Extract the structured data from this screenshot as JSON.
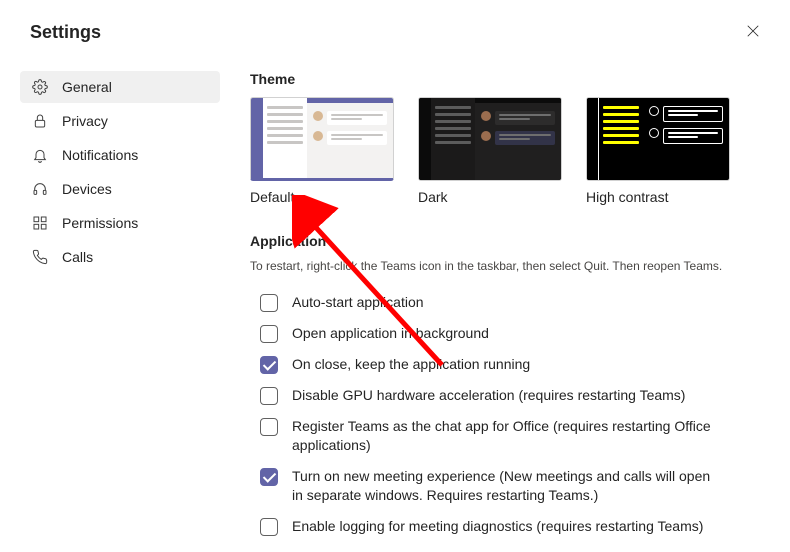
{
  "header": {
    "title": "Settings"
  },
  "sidebar": {
    "items": [
      {
        "key": "general",
        "label": "General",
        "active": true
      },
      {
        "key": "privacy",
        "label": "Privacy",
        "active": false
      },
      {
        "key": "notifications",
        "label": "Notifications",
        "active": false
      },
      {
        "key": "devices",
        "label": "Devices",
        "active": false
      },
      {
        "key": "permissions",
        "label": "Permissions",
        "active": false
      },
      {
        "key": "calls",
        "label": "Calls",
        "active": false
      }
    ]
  },
  "theme": {
    "section_title": "Theme",
    "options": [
      {
        "key": "default",
        "label": "Default",
        "selected": true
      },
      {
        "key": "dark",
        "label": "Dark",
        "selected": false
      },
      {
        "key": "high-contrast",
        "label": "High contrast",
        "selected": false
      }
    ]
  },
  "application": {
    "section_title": "Application",
    "hint": "To restart, right-click the Teams icon in the taskbar, then select Quit. Then reopen Teams.",
    "options": [
      {
        "key": "auto-start",
        "label": "Auto-start application",
        "checked": false
      },
      {
        "key": "open-bg",
        "label": "Open application in background",
        "checked": false
      },
      {
        "key": "on-close-run",
        "label": "On close, keep the application running",
        "checked": true
      },
      {
        "key": "disable-gpu",
        "label": "Disable GPU hardware acceleration (requires restarting Teams)",
        "checked": false
      },
      {
        "key": "reg-chat-app",
        "label": "Register Teams as the chat app for Office (requires restarting Office applications)",
        "checked": false
      },
      {
        "key": "new-meeting",
        "label": "Turn on new meeting experience (New meetings and calls will open in separate windows. Requires restarting Teams.)",
        "checked": true
      },
      {
        "key": "diag-logging",
        "label": "Enable logging for meeting diagnostics (requires restarting Teams)",
        "checked": false
      }
    ]
  },
  "colors": {
    "accent": "#6264a7",
    "arrow": "#ff0000"
  }
}
